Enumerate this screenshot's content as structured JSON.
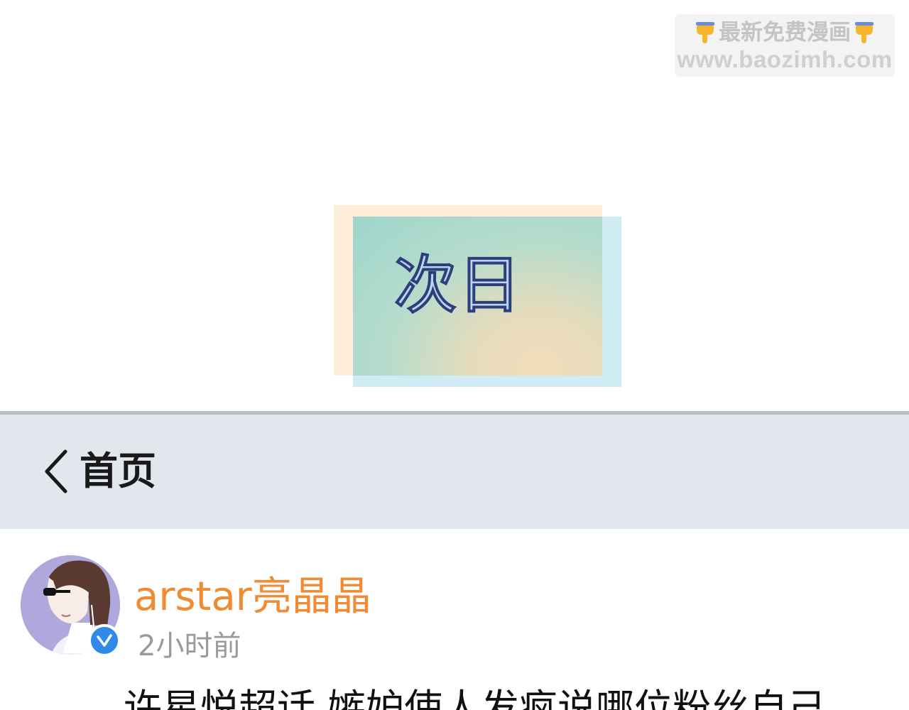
{
  "watermark": {
    "line1": "最新免费漫画",
    "line2": "www.baozimh.com",
    "left_icon": "pointing-down-hand-icon",
    "right_icon": "pointing-down-hand-icon"
  },
  "scene_card": {
    "title": "次日"
  },
  "nav": {
    "back_icon": "chevron-left-icon",
    "back_label": "首页"
  },
  "post": {
    "username": "arstar亮晶晶",
    "timestamp": "2小时前",
    "verified_icon": "verified-check-icon",
    "text": "许星悦超话 嫉妒使人发疯说哪位粉丝自己"
  },
  "colors": {
    "nav_background": "#e2e7ee",
    "username": "#f08a33",
    "verified": "#2f8ae8",
    "timestamp": "#9a9a9a"
  }
}
